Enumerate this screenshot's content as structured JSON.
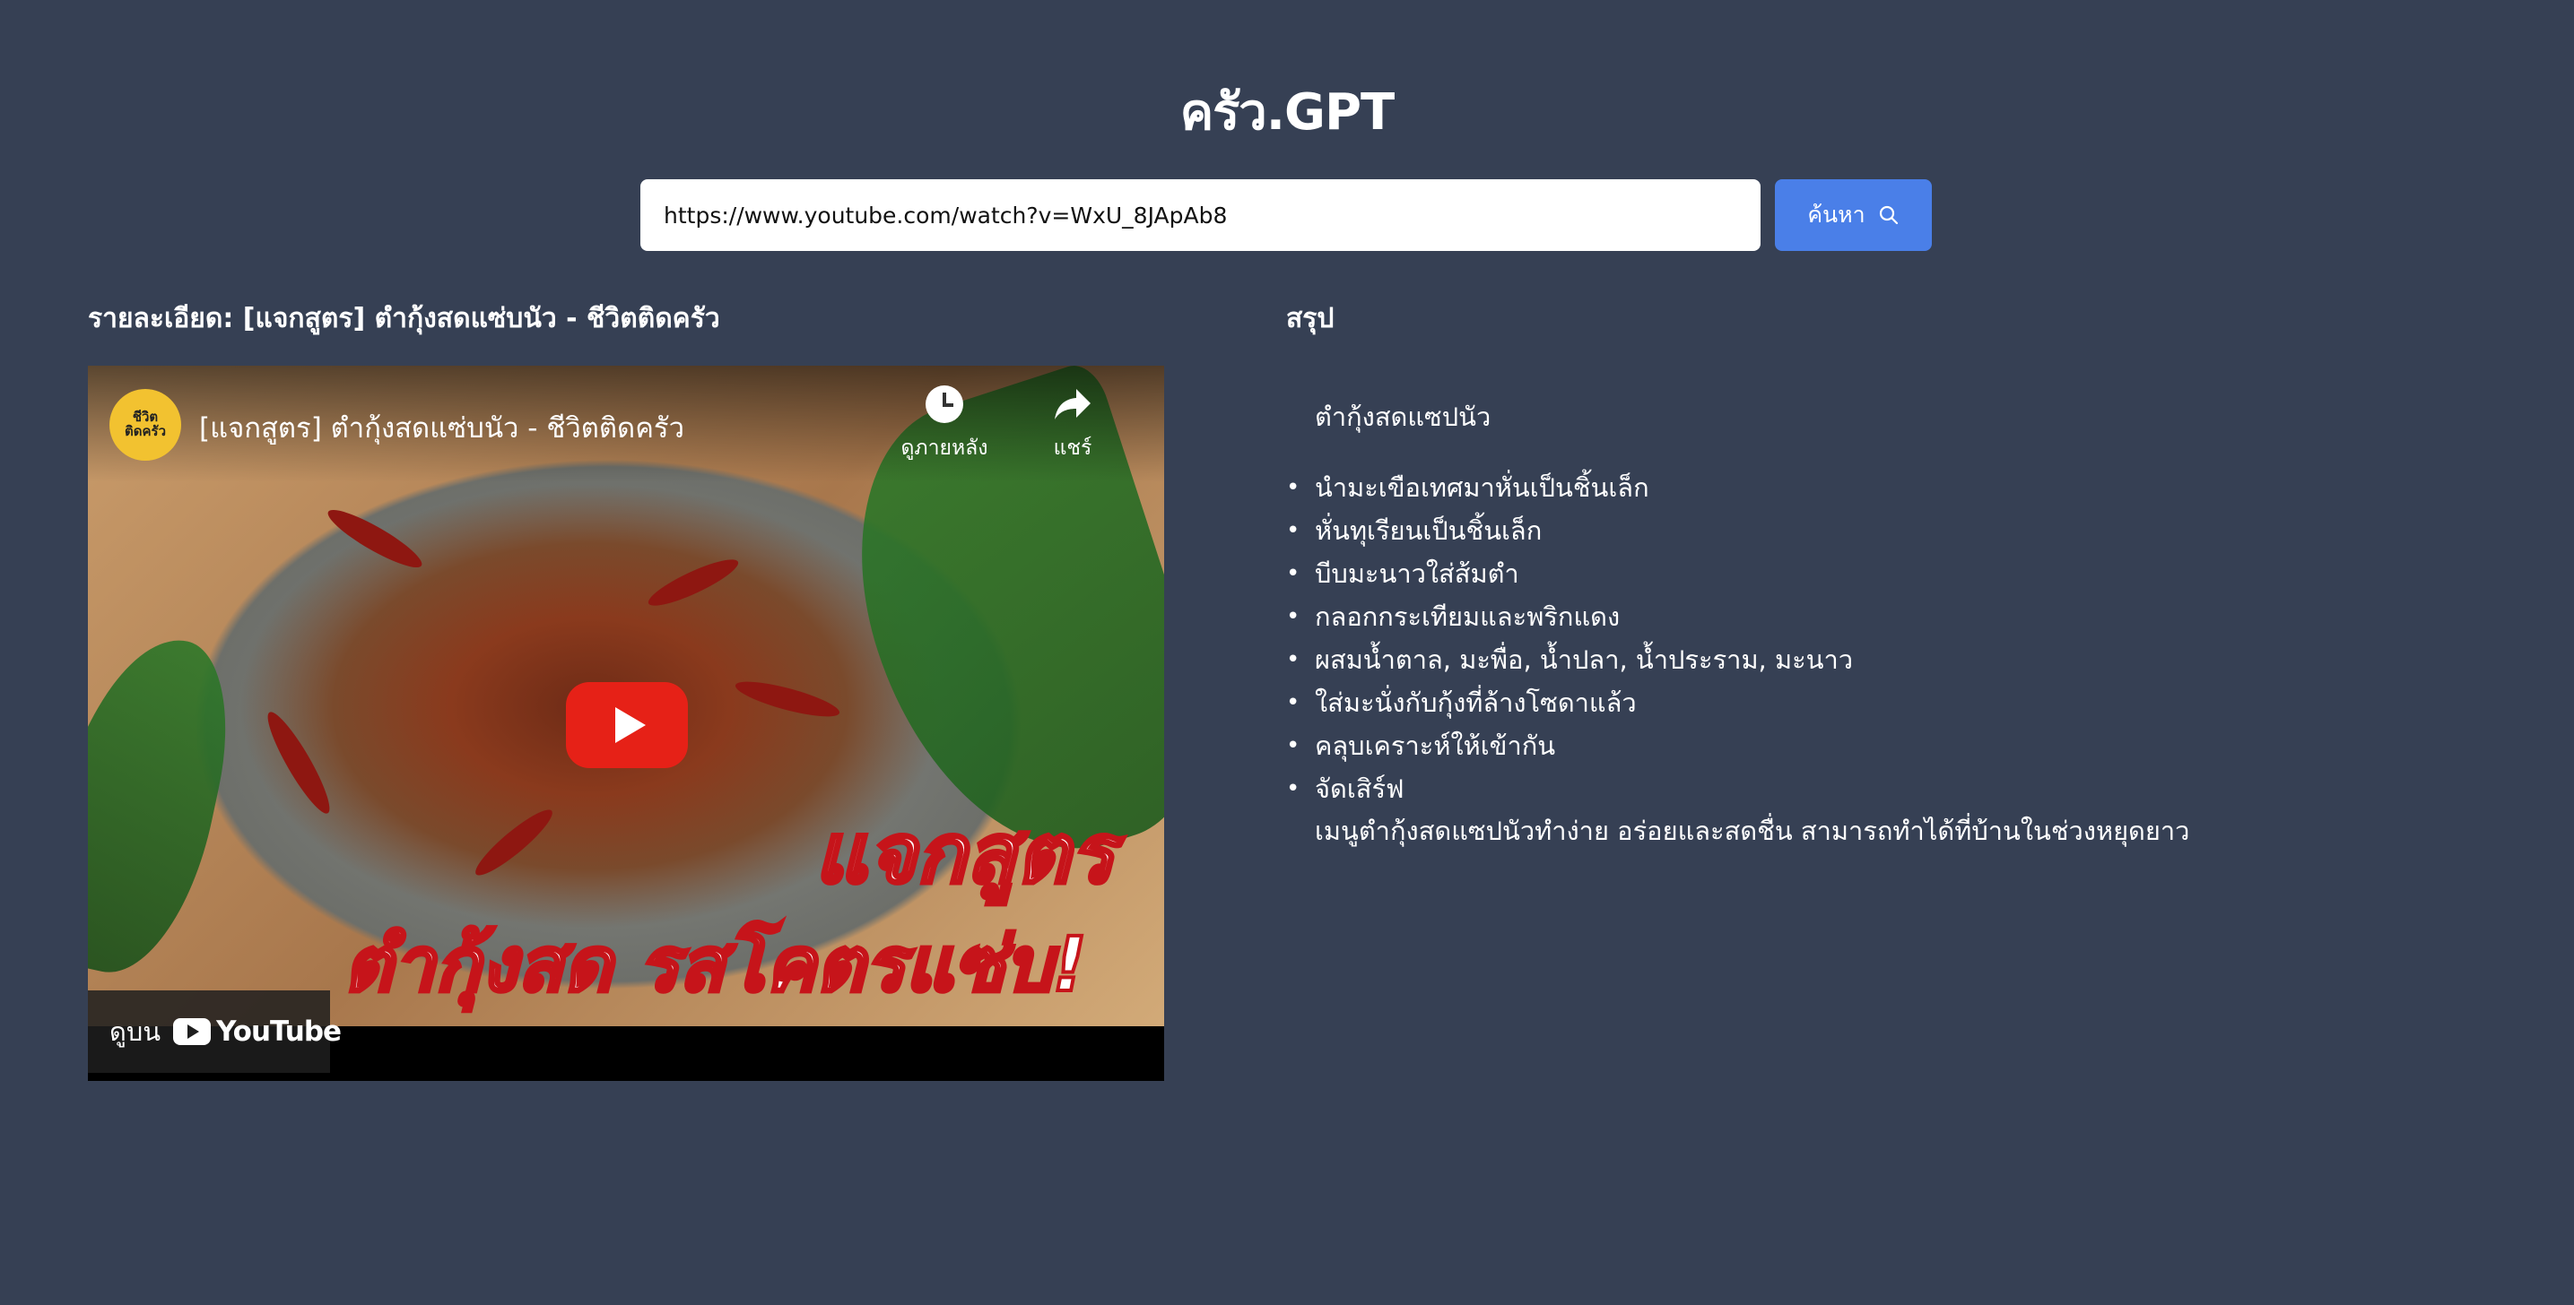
{
  "app": {
    "title": "ครัว.GPT"
  },
  "search": {
    "value": "https://www.youtube.com/watch?v=WxU_8JApAb8",
    "button_label": "ค้นหา",
    "button_icon": "search-icon"
  },
  "details": {
    "heading": "รายละเอียด: [แจกสูตร] ตำกุ้งสดแซ่บนัว - ชีวิตติดครัว"
  },
  "video": {
    "title": "[แจกสูตร] ตำกุ้งสดแซ่บนัว - ชีวิตติดครัว",
    "channel_logo_text": "ชีวิต\nติดครัว",
    "watch_later_label": "ดูภายหลัง",
    "share_label": "แชร์",
    "watch_on_label": "ดูบน",
    "youtube_label": "YouTube",
    "thumbnail_text_line1": "แจกสูตร",
    "thumbnail_text_line2": "ตำกุ้งสด รสโคตรแซ่บ!"
  },
  "summary": {
    "heading": "สรุป",
    "dish_name": "ตำกุ้งสดแซปนัว",
    "steps": [
      "นำมะเขือเทศมาหั่นเป็นชิ้นเล็ก",
      "หั่นทุเรียนเป็นชิ้นเล็ก",
      "บีบมะนาวใส่ส้มตำ",
      "กลอกกระเทียมและพริกแดง",
      "ผสมน้ำตาล, มะพื่อ, น้ำปลา, น้ำประราม, มะนาว",
      "ใส่มะนั่งกับกุ้งที่ล้างโซดาแล้ว",
      "คลุบเคราะห์ให้เข้ากัน",
      "จัดเสิร์ฟ"
    ],
    "conclusion": "เมนูตำกุ้งสดแซปนัวทำง่าย อร่อยและสดชื่น สามารถทำได้ที่บ้านในช่วงหยุดยาว"
  },
  "colors": {
    "background": "#364054",
    "accent": "#4a7fe8",
    "play_button": "#e62117"
  }
}
